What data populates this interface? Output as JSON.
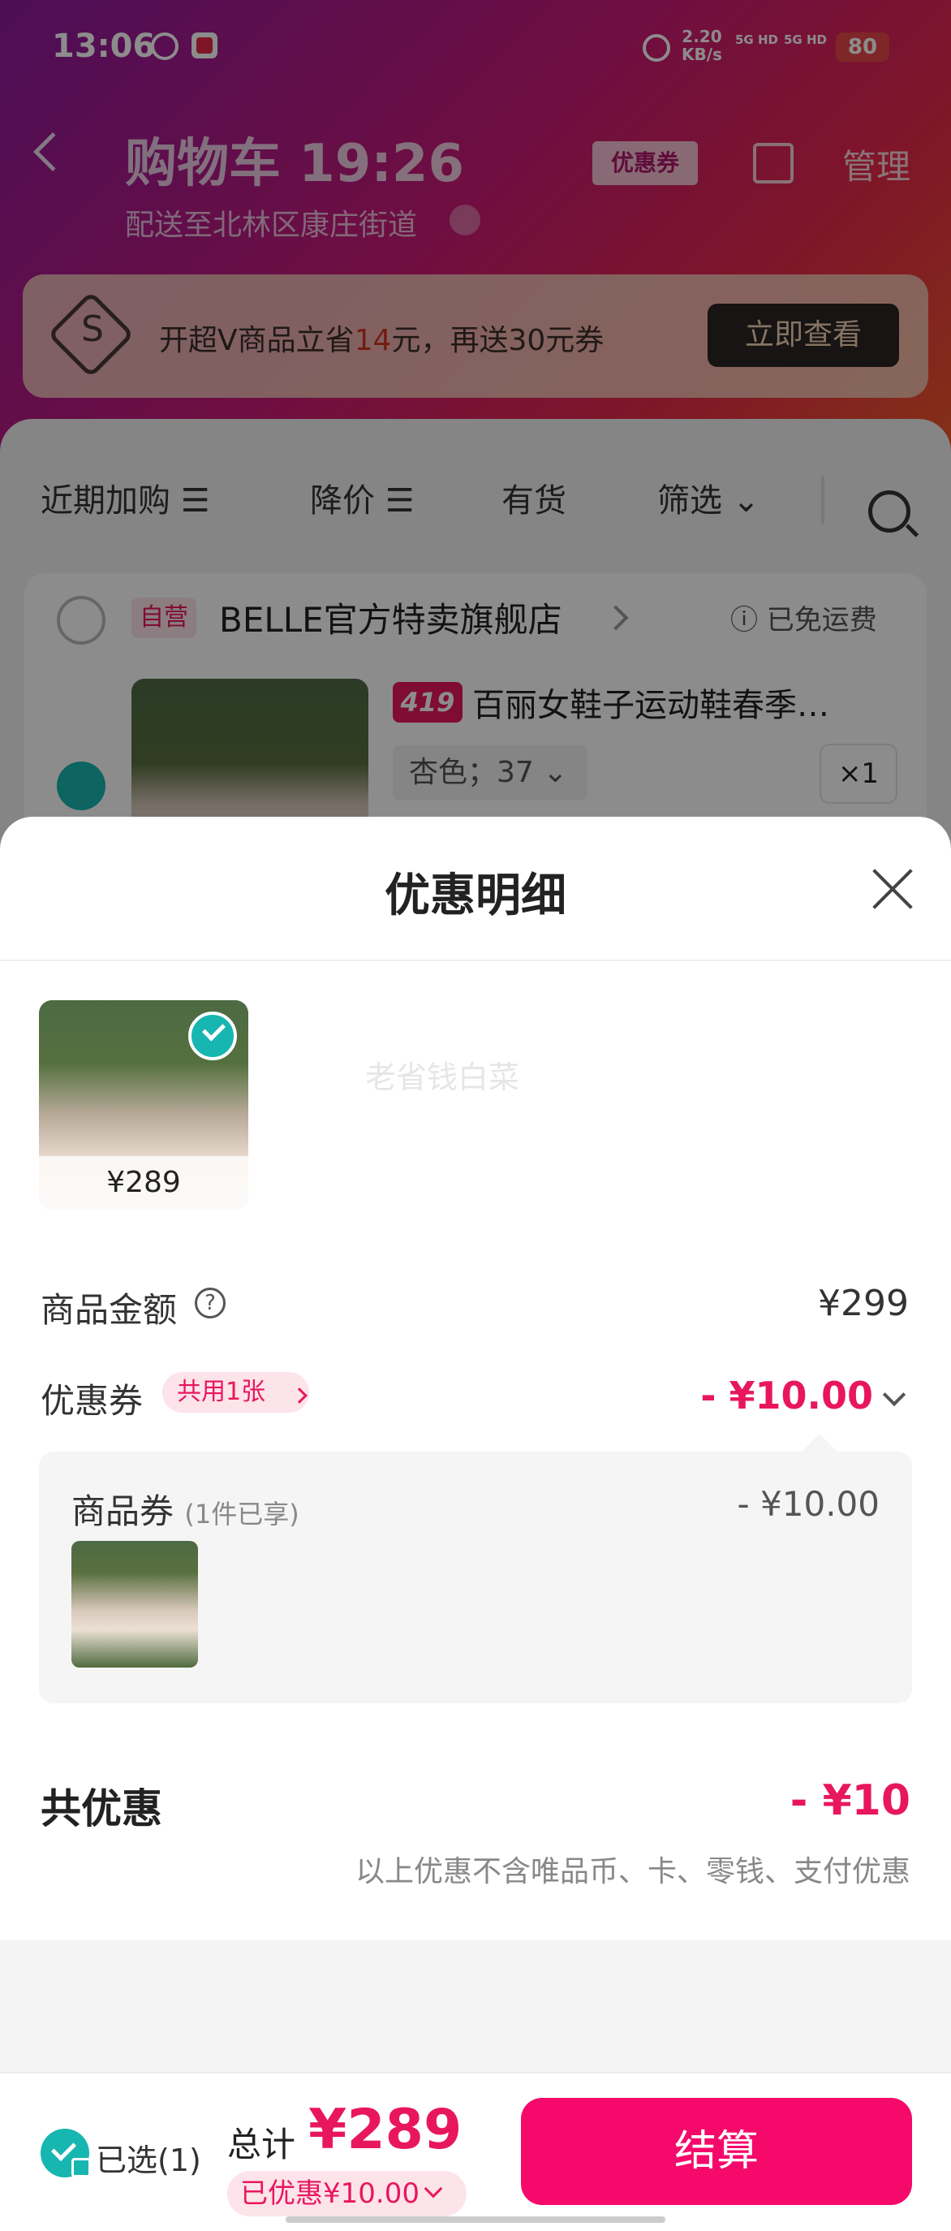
{
  "status_bar": {
    "time": "13:06",
    "speed_value": "2.20",
    "speed_unit": "KB/s",
    "net1": "5G HD",
    "net2": "5G HD",
    "battery": "80"
  },
  "nav": {
    "title": "购物车 19:26",
    "subtitle": "配送至北林区康庄街道",
    "coupon_tag": "优惠券",
    "manage": "管理"
  },
  "vip_banner": {
    "text_before": "开超V商品立省",
    "highlight": "14",
    "text_after": "元，再送30元券",
    "button": "立即查看",
    "icon_letter": "S"
  },
  "filters": [
    "近期加购 ☰",
    "降价 ☰",
    "有货",
    "筛选 ⌄"
  ],
  "store": {
    "self_badge": "自营",
    "name": "BELLE官方特卖旗舰店",
    "free_shipping": "ⓘ 已免运费"
  },
  "item": {
    "tag": "419",
    "title": "百丽女鞋子运动鞋春季…",
    "sku": "杏色；37 ⌄",
    "qty": "×1"
  },
  "sheet": {
    "title": "优惠明细",
    "watermark": "老省钱白菜",
    "thumb_price": "¥289",
    "goods_amount_label": "商品金额",
    "goods_amount_value": "¥299",
    "coupon_label": "优惠券",
    "coupon_chip": "共用1张",
    "coupon_amount": "- ¥10.00",
    "panel": {
      "title": "商品券",
      "sub": "(1件已享)",
      "amount": "- ¥10.00"
    },
    "total_label": "共优惠",
    "total_amount": "- ¥10",
    "total_note": "以上优惠不含唯品币、卡、零钱、支付优惠"
  },
  "bottom_bar": {
    "selected": "已选(1)",
    "total_label": "总计",
    "total_amount": "¥289",
    "discount": "已优惠¥10.00",
    "checkout": "结算"
  }
}
